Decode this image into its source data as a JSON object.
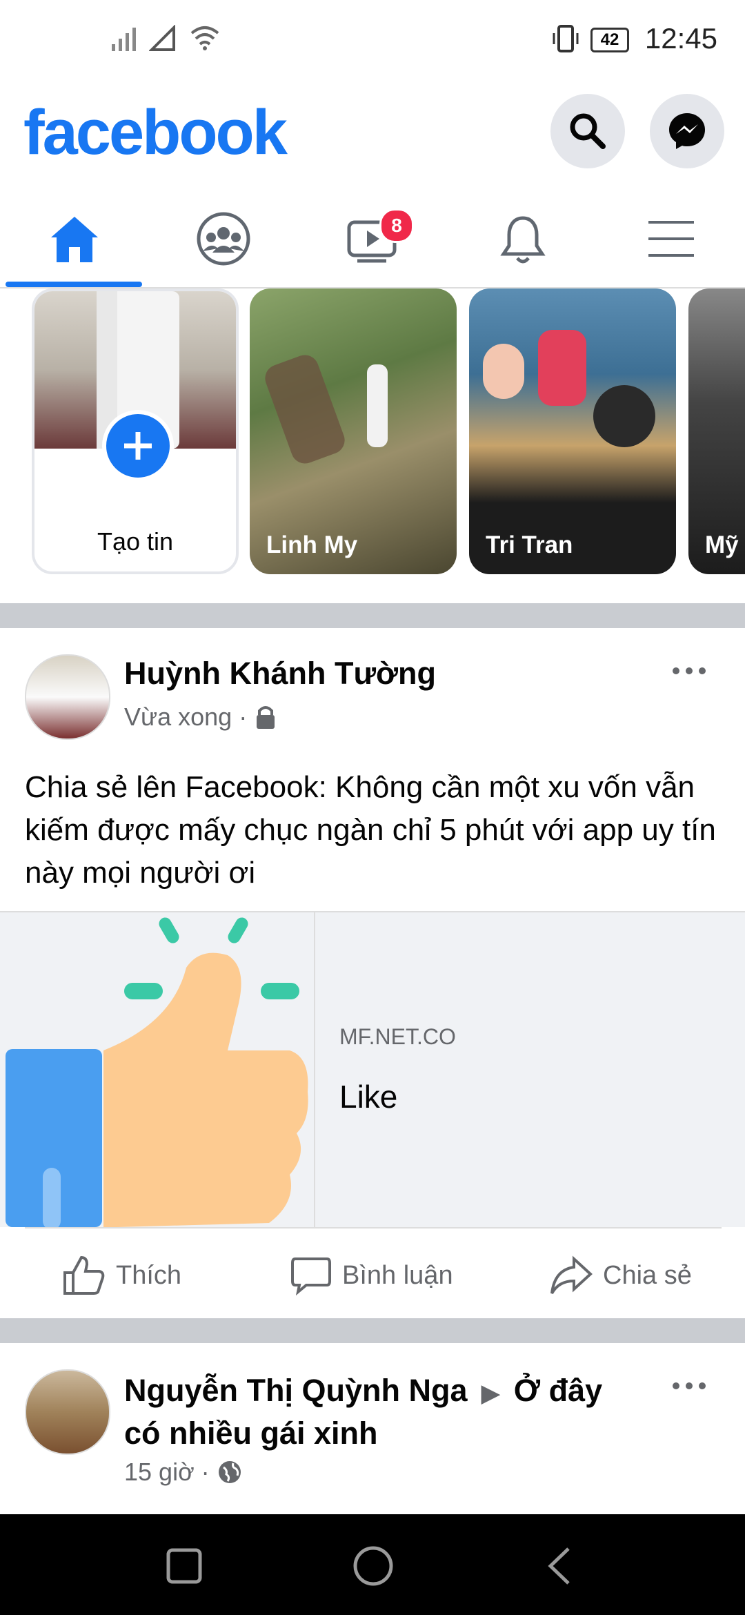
{
  "status_bar": {
    "battery": "42",
    "time": "12:45"
  },
  "header": {
    "logo": "facebook",
    "search_icon": "search-icon",
    "messenger_icon": "messenger-icon"
  },
  "tabs": [
    {
      "name": "home",
      "icon": "home-icon",
      "active": true
    },
    {
      "name": "groups",
      "icon": "groups-icon"
    },
    {
      "name": "watch",
      "icon": "video-icon",
      "badge": "8"
    },
    {
      "name": "notifications",
      "icon": "bell-icon"
    },
    {
      "name": "menu",
      "icon": "menu-icon"
    }
  ],
  "stories": {
    "create_label": "Tạo tin",
    "items": [
      {
        "name": "Linh My"
      },
      {
        "name": "Tri Tran"
      },
      {
        "name": "Mỹ"
      }
    ]
  },
  "post1": {
    "author": "Huỳnh Khánh Tường",
    "time": "Vừa xong",
    "privacy_icon": "lock-icon",
    "text": "Chia sẻ lên Facebook: Không cần một xu vốn vẫn kiếm được mấy chục ngàn chỉ 5 phút với app uy tín này mọi người ơi",
    "link": {
      "domain": "MF.NET.CO",
      "title": "Like"
    },
    "actions": {
      "like": "Thích",
      "comment": "Bình luận",
      "share": "Chia sẻ"
    }
  },
  "post2": {
    "author": "Nguyễn Thị Quỳnh Nga",
    "group": "Ở đây có nhiều gái xinh",
    "time": "15 giờ",
    "privacy_icon": "globe-icon"
  },
  "colors": {
    "brand": "#1877f2",
    "badge": "#f02849",
    "muted": "#65676b"
  }
}
